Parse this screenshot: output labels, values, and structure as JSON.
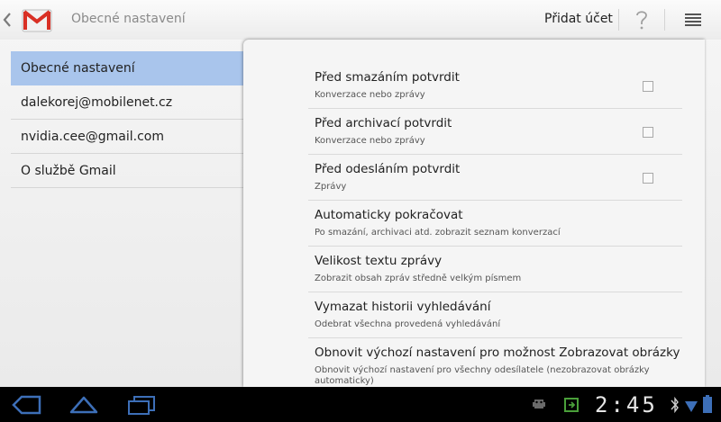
{
  "actionbar": {
    "title": "Obecné nastavení",
    "add_account_label": "Přidat účet"
  },
  "left_list": {
    "items": [
      {
        "label": "Obecné nastavení",
        "selected": true
      },
      {
        "label": "dalekorej@mobilenet.cz",
        "selected": false
      },
      {
        "label": "nvidia.cee@gmail.com",
        "selected": false
      },
      {
        "label": "O službě Gmail",
        "selected": false
      }
    ]
  },
  "preferences": [
    {
      "title": "Před smazáním potvrdit",
      "summary": "Konverzace nebo zprávy",
      "checked": false
    },
    {
      "title": "Před archivací potvrdit",
      "summary": "Konverzace nebo zprávy",
      "checked": false
    },
    {
      "title": "Před odesláním potvrdit",
      "summary": "Zprávy",
      "checked": false
    },
    {
      "title": "Automaticky pokračovat",
      "summary": "Po smazání, archivaci atd. zobrazit seznam konverzací"
    },
    {
      "title": "Velikost textu zprávy",
      "summary": "Zobrazit obsah zpráv středně velkým písmem"
    },
    {
      "title": "Vymazat historii vyhledávání",
      "summary": "Odebrat všechna provedená vyhledávání"
    },
    {
      "title": "Obnovit výchozí nastavení pro možnost Zobrazovat obrázky",
      "summary": "Obnovit výchozí nastavení pro všechny odesílatele (nezobrazovat obrázky",
      "summary_cont": "automaticky)"
    }
  ],
  "statusbar": {
    "time": "2:45"
  },
  "colors": {
    "selected_item": "#a9c5ec",
    "gmail_red": "#d93025"
  }
}
